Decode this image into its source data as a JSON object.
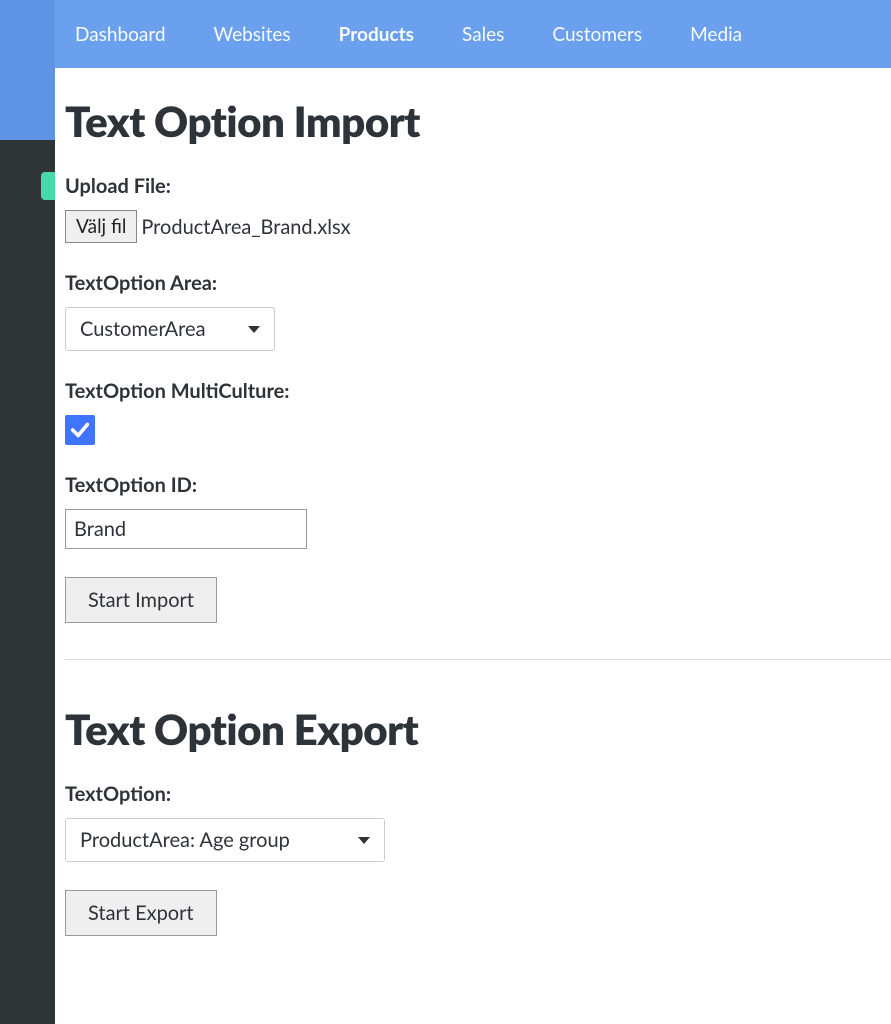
{
  "nav": {
    "items": [
      {
        "label": "Dashboard",
        "active": false
      },
      {
        "label": "Websites",
        "active": false
      },
      {
        "label": "Products",
        "active": true
      },
      {
        "label": "Sales",
        "active": false
      },
      {
        "label": "Customers",
        "active": false
      },
      {
        "label": "Media",
        "active": false
      }
    ]
  },
  "import": {
    "heading": "Text Option Import",
    "upload_label": "Upload File:",
    "file_button": "Välj fil",
    "file_name": "ProductArea_Brand.xlsx",
    "area_label": "TextOption Area:",
    "area_value": "CustomerArea",
    "multiculture_label": "TextOption MultiCulture:",
    "multiculture_checked": true,
    "id_label": "TextOption ID:",
    "id_value": "Brand",
    "start_button": "Start Import"
  },
  "export": {
    "heading": "Text Option Export",
    "textoption_label": "TextOption:",
    "textoption_value": "ProductArea: Age group",
    "start_button": "Start Export"
  }
}
